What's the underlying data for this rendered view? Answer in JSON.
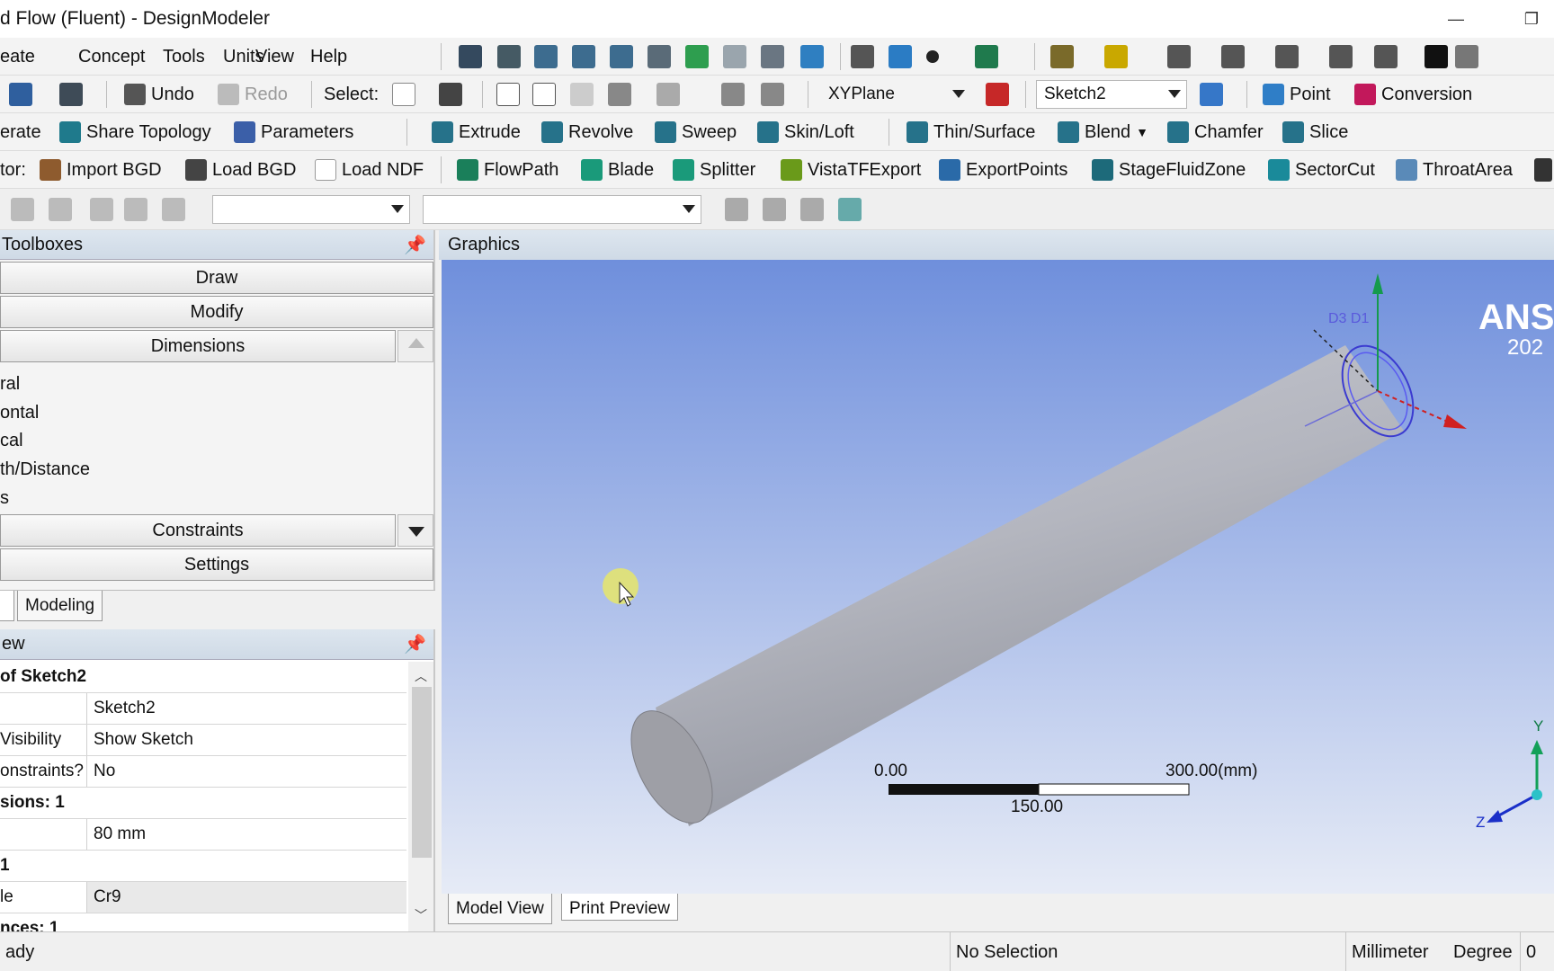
{
  "window": {
    "title": "d Flow (Fluent) - DesignModeler",
    "minimize": "—",
    "restore": "❐"
  },
  "menu": [
    "eate",
    "Concept",
    "Tools",
    "Units",
    "View",
    "Help"
  ],
  "toolbar2": {
    "undo": "Undo",
    "redo": "Redo",
    "select": "Select:",
    "plane": "XYPlane",
    "sketch": "Sketch2",
    "point": "Point",
    "conversion": "Conversion"
  },
  "toolbar3": {
    "generate": "erate",
    "share_topology": "Share Topology",
    "parameters": "Parameters",
    "extrude": "Extrude",
    "revolve": "Revolve",
    "sweep": "Sweep",
    "skin_loft": "Skin/Loft",
    "thin_surface": "Thin/Surface",
    "blend": "Blend",
    "chamfer": "Chamfer",
    "slice": "Slice"
  },
  "toolbar4": {
    "label": "tor:",
    "import_bgd": "Import BGD",
    "load_bgd": "Load BGD",
    "load_ndf": "Load NDF",
    "flowpath": "FlowPath",
    "blade": "Blade",
    "splitter": "Splitter",
    "vista_tf_export": "VistaTFExport",
    "export_points": "ExportPoints",
    "stage_fluid_zone": "StageFluidZone",
    "sector_cut": "SectorCut",
    "throat_area": "ThroatArea"
  },
  "toolboxes": {
    "header": "Toolboxes",
    "draw": "Draw",
    "modify": "Modify",
    "dimensions": "Dimensions",
    "dimension_items": [
      "ral",
      "ontal",
      "cal",
      "th/Distance",
      "s"
    ],
    "constraints": "Constraints",
    "settings": "Settings"
  },
  "tabs": {
    "modeling": "Modeling"
  },
  "details": {
    "header": "ew",
    "title": "of Sketch2",
    "rows": [
      {
        "label": "",
        "value": "Sketch2"
      },
      {
        "label": "Visibility",
        "value": "Show Sketch"
      },
      {
        "label": "onstraints?",
        "value": "No"
      },
      {
        "label": "sions: 1",
        "value": ""
      },
      {
        "label": "",
        "value": "80 mm"
      },
      {
        "label": "1",
        "value": ""
      },
      {
        "label": "le",
        "value": "Cr9"
      },
      {
        "label": "nces: 1",
        "value": ""
      }
    ]
  },
  "graphics": {
    "header": "Graphics",
    "logo": "ANS",
    "year": "202",
    "dim_label": "D3 D1",
    "scale": {
      "left": "0.00",
      "right": "300.00(mm)",
      "mid": "150.00"
    },
    "axes": {
      "y": "Y",
      "z": "Z"
    },
    "tabs": {
      "model_view": "Model View",
      "print_preview": "Print Preview"
    }
  },
  "status": {
    "ready": "ady",
    "selection": "No Selection",
    "units": "Millimeter",
    "angle": "Degree",
    "value": "0"
  }
}
